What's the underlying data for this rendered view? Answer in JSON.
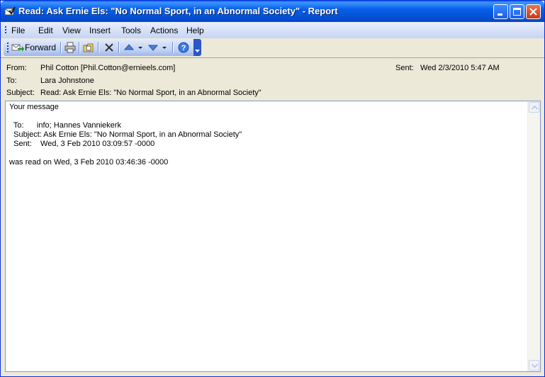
{
  "window": {
    "title": "Read: Ask Ernie Els: \"No Normal Sport, in an Abnormal Society\"  - Report"
  },
  "menu": {
    "items": [
      "File",
      "Edit",
      "View",
      "Insert",
      "Tools",
      "Actions",
      "Help"
    ]
  },
  "toolbar": {
    "forward_label": "Forward"
  },
  "headers": {
    "from_label": "From:",
    "from_value": "Phil Cotton [Phil.Cotton@ernieels.com]",
    "to_label": "To:",
    "to_value": "Lara Johnstone",
    "subject_label": "Subject:",
    "subject_value": "Read: Ask Ernie Els: \"No Normal Sport, in an Abnormal Society\"",
    "sent_label": "Sent:",
    "sent_value": "Wed 2/3/2010 5:47 AM"
  },
  "body": {
    "line1": "Your message",
    "line2": "  To:      info; Hannes Vanniekerk",
    "line3": "  Subject: Ask Ernie Els: \"No Normal Sport, in an Abnormal Society\"",
    "line4": "  Sent:    Wed, 3 Feb 2010 03:09:57 -0000",
    "line5": "was read on Wed, 3 Feb 2010 03:46:36 -0000"
  },
  "colors": {
    "titlebar": "#0453d9",
    "menubar": "#c6d5f5",
    "header_bg": "#ece9d8",
    "close_button": "#c5391a"
  }
}
